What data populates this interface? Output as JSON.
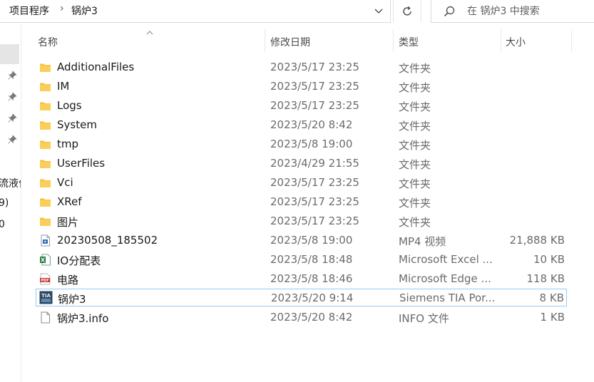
{
  "breadcrumb": {
    "items": [
      "项目程序",
      "锅炉3"
    ],
    "separator": "›"
  },
  "search": {
    "placeholder": "在 锅炉3 中搜索"
  },
  "nav": {
    "partial_labels": [
      "流液位",
      "9)",
      "0"
    ]
  },
  "columns": {
    "name": "名称",
    "date": "修改日期",
    "type": "类型",
    "size": "大小"
  },
  "files": [
    {
      "name": "AdditionalFiles",
      "date": "2023/5/17 23:25",
      "type": "文件夹",
      "size": "",
      "icon": "folder-icon"
    },
    {
      "name": "IM",
      "date": "2023/5/17 23:25",
      "type": "文件夹",
      "size": "",
      "icon": "folder-icon"
    },
    {
      "name": "Logs",
      "date": "2023/5/17 23:25",
      "type": "文件夹",
      "size": "",
      "icon": "folder-icon"
    },
    {
      "name": "System",
      "date": "2023/5/20 8:42",
      "type": "文件夹",
      "size": "",
      "icon": "folder-icon"
    },
    {
      "name": "tmp",
      "date": "2023/5/8 19:00",
      "type": "文件夹",
      "size": "",
      "icon": "folder-icon"
    },
    {
      "name": "UserFiles",
      "date": "2023/4/29 21:55",
      "type": "文件夹",
      "size": "",
      "icon": "folder-icon"
    },
    {
      "name": "Vci",
      "date": "2023/5/17 23:25",
      "type": "文件夹",
      "size": "",
      "icon": "folder-icon"
    },
    {
      "name": "XRef",
      "date": "2023/5/17 23:25",
      "type": "文件夹",
      "size": "",
      "icon": "folder-icon"
    },
    {
      "name": "图片",
      "date": "2023/5/17 23:25",
      "type": "文件夹",
      "size": "",
      "icon": "folder-icon"
    },
    {
      "name": "20230508_185502",
      "date": "2023/5/8 19:00",
      "type": "MP4 视频",
      "size": "21,888 KB",
      "icon": "video-file-icon"
    },
    {
      "name": "IO分配表",
      "date": "2023/5/8 18:48",
      "type": "Microsoft Excel ...",
      "size": "10 KB",
      "icon": "excel-file-icon"
    },
    {
      "name": "电路",
      "date": "2023/5/8 18:46",
      "type": "Microsoft Edge ...",
      "size": "118 KB",
      "icon": "pdf-file-icon"
    },
    {
      "name": "锅炉3",
      "date": "2023/5/20 9:14",
      "type": "Siemens TIA Por...",
      "size": "8 KB",
      "icon": "tia-portal-file-icon"
    },
    {
      "name": "锅炉3.info",
      "date": "2023/5/20 8:42",
      "type": "INFO 文件",
      "size": "1 KB",
      "icon": "blank-file-icon"
    }
  ],
  "colors": {
    "folder": "#f6c244",
    "focus_border": "#99c9ef",
    "selected_nav": "#e5e5e5"
  }
}
